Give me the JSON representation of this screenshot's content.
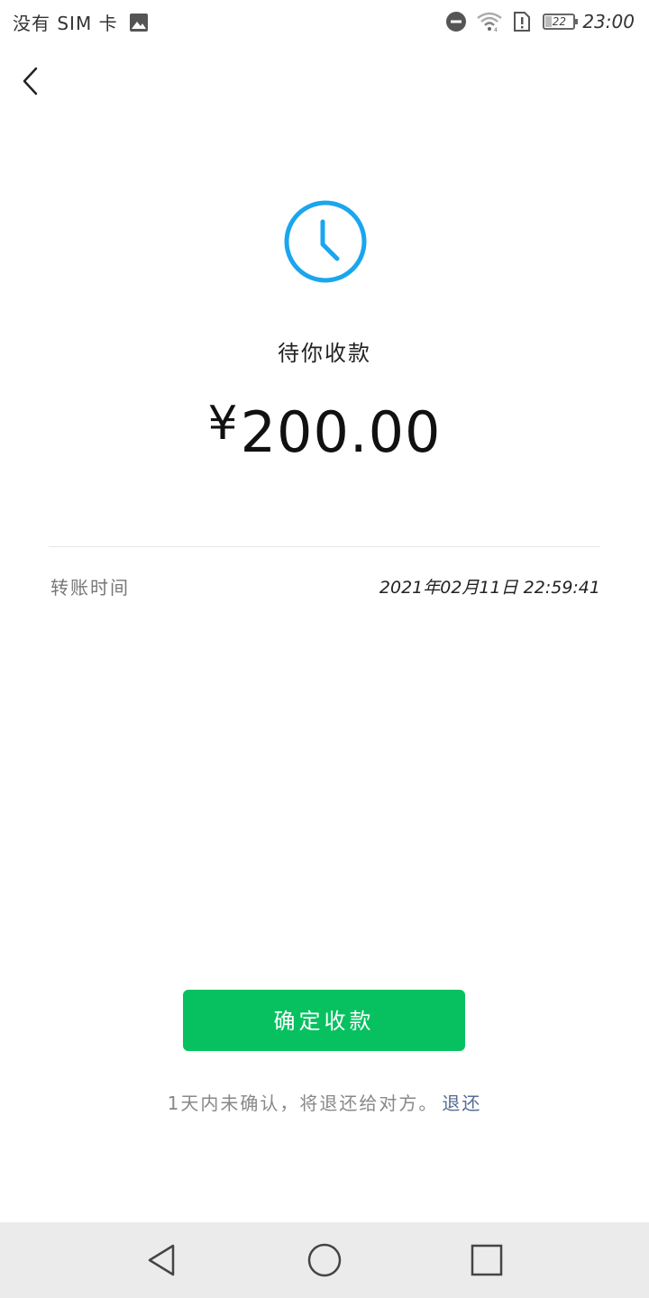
{
  "status_bar": {
    "carrier": "没有 SIM 卡",
    "battery_level": "22",
    "time": "23:00"
  },
  "transfer": {
    "status_title": "待你收款",
    "currency_symbol": "¥",
    "amount": "200.00",
    "time_label": "转账时间",
    "time_value": "2021年02月11日  22:59:41"
  },
  "actions": {
    "confirm_label": "确定收款",
    "notice_text": "1天内未确认，将退还给对方。",
    "return_link": "退还"
  },
  "colors": {
    "accent_green": "#07c160",
    "clock_blue": "#1aa6ee",
    "link_blue": "#576b95",
    "nav_bar_bg": "#ebebeb"
  },
  "icons": {
    "back": "chevron-left-icon",
    "pending": "clock-icon",
    "gallery": "image-icon",
    "dnd": "do-not-disturb-icon",
    "wifi": "wifi-icon",
    "sim_alert": "sim-alert-icon",
    "battery": "battery-icon",
    "nav_back": "triangle-back-icon",
    "nav_home": "circle-home-icon",
    "nav_recent": "square-recent-icon"
  }
}
